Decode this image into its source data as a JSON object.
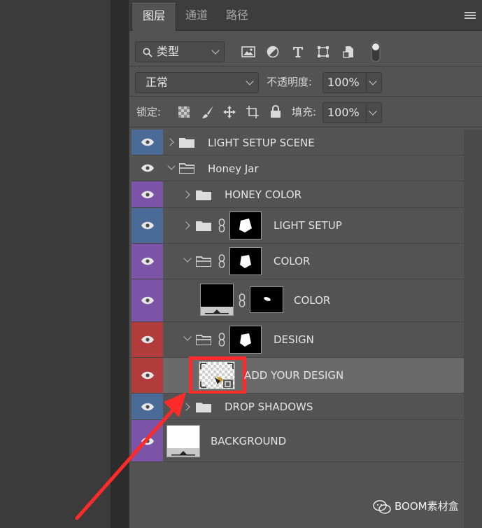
{
  "tabs": [
    {
      "label": "图层",
      "active": true
    },
    {
      "label": "通道",
      "active": false
    },
    {
      "label": "路径",
      "active": false
    }
  ],
  "filter": {
    "label": "类型"
  },
  "blend": {
    "mode": "正常",
    "opacity_label": "不透明度:",
    "opacity_value": "100%"
  },
  "lock": {
    "label": "锁定:",
    "fill_label": "填充:",
    "fill_value": "100%"
  },
  "layers": [
    {
      "name": "LIGHT SETUP SCENE",
      "type": "group",
      "expanded": false,
      "color": "#4a6a97"
    },
    {
      "name": "Honey Jar",
      "type": "group",
      "expanded": true,
      "color": "none"
    },
    {
      "name": "HONEY COLOR",
      "type": "group",
      "expanded": false,
      "color": "#7b53a7"
    },
    {
      "name": "LIGHT SETUP",
      "type": "group-mask",
      "expanded": false,
      "color": "#4a6a97"
    },
    {
      "name": "COLOR",
      "type": "group-mask",
      "expanded": true,
      "color": "#7b53a7"
    },
    {
      "name": "COLOR",
      "type": "fill-mask",
      "color": "#7b53a7"
    },
    {
      "name": "DESIGN",
      "type": "group-mask",
      "expanded": true,
      "color": "#b23b3b"
    },
    {
      "name": "ADD YOUR DESIGN",
      "type": "smart-object",
      "selected": true,
      "color": "#b23b3b"
    },
    {
      "name": "DROP SHADOWS",
      "type": "group",
      "expanded": false,
      "color": "#4a6a97"
    },
    {
      "name": "BACKGROUND",
      "type": "fill",
      "color": "#7b53a7"
    }
  ],
  "colors": {
    "blue": "#4a6a97",
    "purple": "#7b53a7",
    "red": "#b23b3b",
    "highlight": "#ff2a2a"
  },
  "watermark": {
    "text": "BOOM素材盒"
  }
}
